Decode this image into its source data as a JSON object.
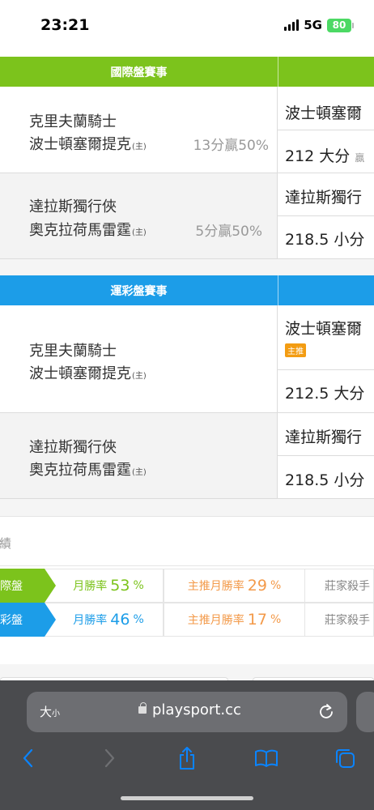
{
  "status_bar": {
    "time": "23:21",
    "network": "5G",
    "battery": "80"
  },
  "international": {
    "title": "國際盤賽事",
    "matches": [
      {
        "away": "克里夫蘭騎士",
        "home": "波士頓塞爾提克",
        "home_mark": "(主)",
        "pct": "13分贏50%",
        "pick_top": "波士頓塞爾",
        "pick_bottom": "212 大分",
        "pick_bottom_sub": "贏"
      },
      {
        "away": "達拉斯獨行俠",
        "home": "奧克拉荷馬雷霆",
        "home_mark": "(主)",
        "pct": "5分贏50%",
        "pick_top": "達拉斯獨行",
        "pick_bottom": "218.5 小分"
      }
    ]
  },
  "lottery": {
    "title": "運彩盤賽事",
    "matches": [
      {
        "away": "克里夫蘭騎士",
        "home": "波士頓塞爾提克",
        "home_mark": "(主)",
        "pick_top": "波士頓塞爾",
        "pick_tag": "主推",
        "pick_bottom": "212.5 大分"
      },
      {
        "away": "達拉斯獨行俠",
        "home": "奧克拉荷馬雷霆",
        "home_mark": "(主)",
        "pick_top": "達拉斯獨行",
        "pick_bottom": "218.5 小分"
      }
    ]
  },
  "record": {
    "label": "戰績",
    "rows": [
      {
        "tag": "國際盤",
        "monthly_label": "月勝率",
        "monthly_value": "53",
        "unit": "%",
        "main_label": "主推月勝率",
        "main_value": "29",
        "main_unit": "%",
        "extra": "莊家殺手"
      },
      {
        "tag": "運彩盤",
        "monthly_label": "月勝率",
        "monthly_value": "46",
        "unit": "%",
        "main_label": "主推月勝率",
        "main_value": "17",
        "main_unit": "%",
        "extra": "莊家殺手"
      }
    ]
  },
  "browser": {
    "text_size": "大",
    "text_size_small": "小",
    "domain": "playsport.cc"
  },
  "colors": {
    "green": "#7cc31c",
    "blue": "#1c9de8",
    "orange": "#f39a4a",
    "browser_bar": "#4a4b4e"
  }
}
